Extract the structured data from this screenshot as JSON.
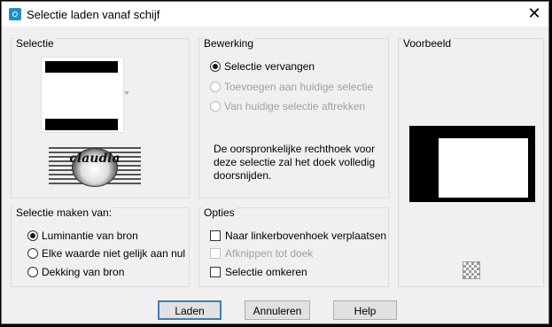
{
  "window": {
    "title": "Selectie laden vanaf schijf",
    "close": "✕"
  },
  "groups": {
    "selectie": "Selectie",
    "bewerking": "Bewerking",
    "voorbeeld": "Voorbeeld",
    "maken": "Selectie maken van:",
    "opties": "Opties"
  },
  "bewerking": {
    "options": [
      "Selectie vervangen",
      "Toevoegen aan huidige selectie",
      "Van huidige selectie aftrekken"
    ],
    "description_lines": [
      "De oorspronkelijke rechthoek voor",
      "deze selectie zal het doek volledig",
      "doorsnijden."
    ]
  },
  "maken": {
    "options": [
      "Luminantie van bron",
      "Elke waarde niet gelijk aan nul",
      "Dekking van bron"
    ]
  },
  "opties": {
    "options": [
      "Naar linkerbovenhoek verplaatsen",
      "Afknippen tot doek",
      "Selectie omkeren"
    ]
  },
  "logo_text": "claudia",
  "buttons": {
    "load": "Laden",
    "cancel": "Annuleren",
    "help": "Help"
  },
  "icons": {
    "app": "app-icon",
    "close": "close-icon",
    "transparency": "checkerboard-icon",
    "dropdown": "chevron-down-icon"
  }
}
